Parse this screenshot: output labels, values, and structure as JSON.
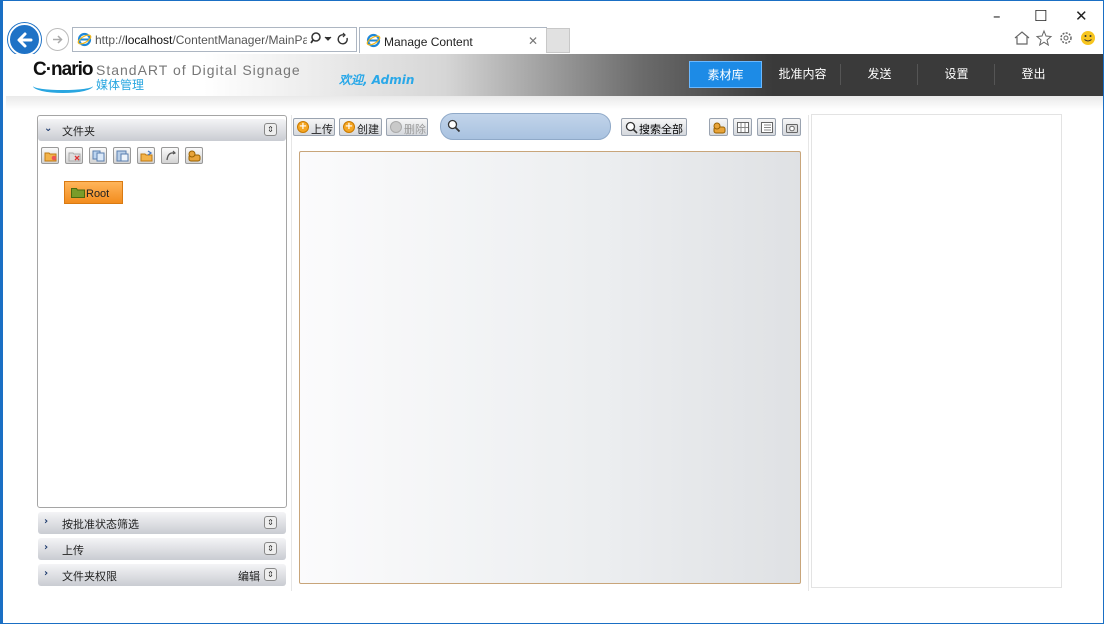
{
  "browser": {
    "url_prefix": "http://",
    "url_host": "localhost",
    "url_path": "/ContentManager/MainPag",
    "tab_title": "Manage Content",
    "window_controls": {
      "minimize": "–",
      "maximize": "☐",
      "close": "✕"
    }
  },
  "header": {
    "logo_brand": "C·nario",
    "logo_tagline": "StandART of Digital Signage",
    "logo_subtitle": "媒体管理",
    "welcome": "欢迎, Admin",
    "nav": [
      {
        "label": "素材库",
        "active": true
      },
      {
        "label": "批准内容",
        "active": false
      },
      {
        "label": "发送",
        "active": false
      },
      {
        "label": "设置",
        "active": false
      },
      {
        "label": "登出",
        "active": false
      }
    ]
  },
  "sidebar": {
    "folders_label": "文件夹",
    "root_folder": "Root",
    "filter_label": "按批准状态筛选",
    "upload_label": "上传",
    "permissions_label": "文件夹权限",
    "permissions_edit": "编辑"
  },
  "toolbar": {
    "upload": "上传",
    "create": "创建",
    "delete": "删除",
    "search_placeholder": "",
    "search_all": "搜索全部"
  },
  "colors": {
    "accent": "#1d8be6",
    "root_folder": "#f59a2e",
    "welcome": "#2aa8e8"
  }
}
